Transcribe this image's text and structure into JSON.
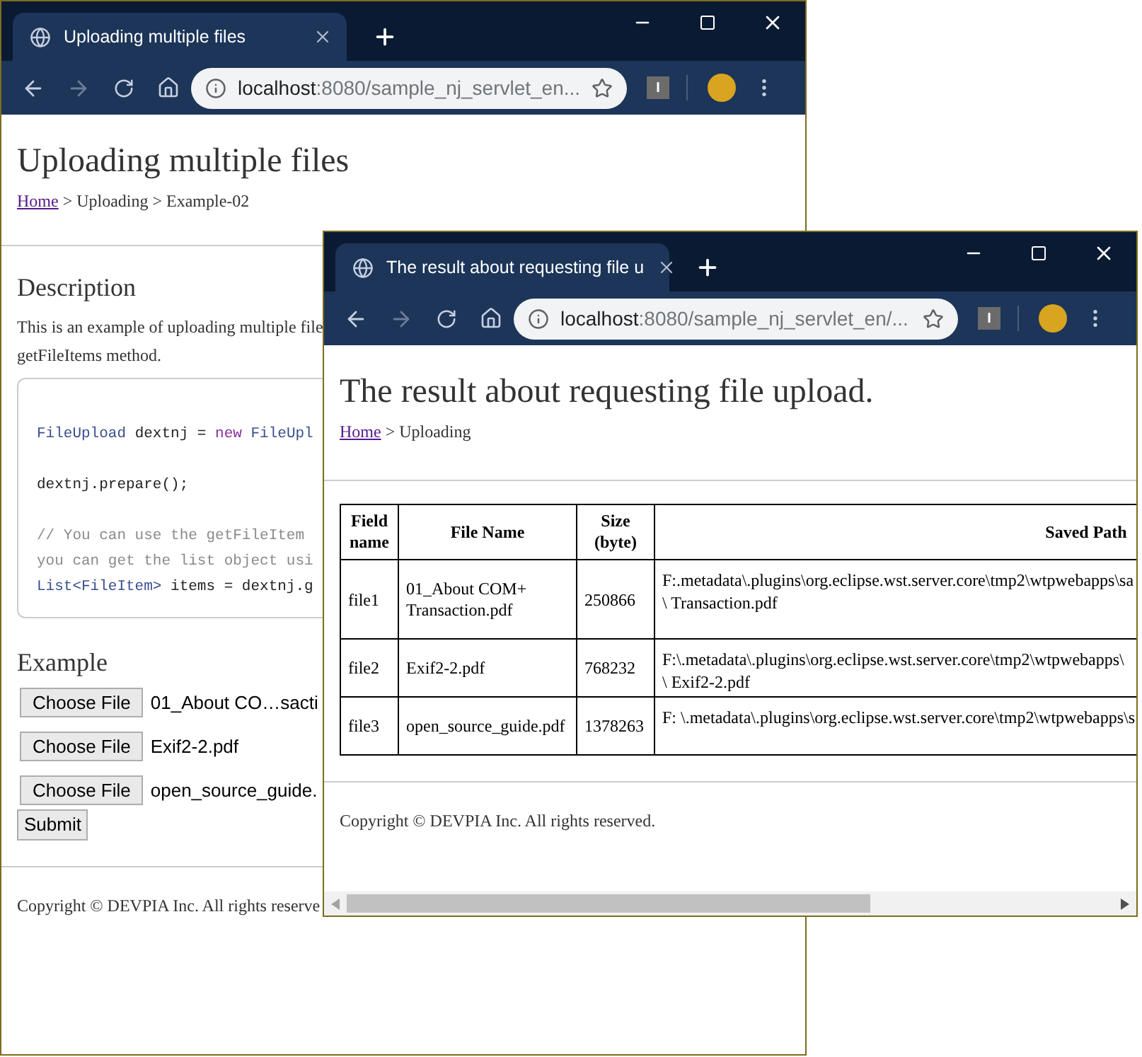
{
  "back_window": {
    "tab_title": "Uploading multiple files",
    "url_host": "localhost",
    "url_rest": ":8080/sample_nj_servlet_en...",
    "nav": {
      "back_disabled": false,
      "forward_disabled": true
    },
    "extension_label": "I",
    "heading": "Uploading multiple files",
    "breadcrumb": {
      "link": "Home",
      "rest": " > Uploading > Example-02"
    },
    "description": {
      "heading": "Description",
      "lines": [
        "This is an example of uploading multiple file",
        "getFileItems method."
      ]
    },
    "code_blocks": [
      [
        [
          {
            "text": "FileUpload",
            "kind": "type"
          },
          {
            "text": " dextnj = ",
            "kind": "plain"
          },
          {
            "text": "new",
            "kind": "keyword"
          },
          {
            "text": " FileUpl",
            "kind": "type"
          }
        ]
      ],
      [
        [
          {
            "text": "dextnj.prepare();",
            "kind": "plain"
          }
        ]
      ],
      [
        [
          {
            "text": "// You can use the getFileItem",
            "kind": "comment"
          }
        ],
        [
          {
            "text": "you can get the list object usi",
            "kind": "comment"
          }
        ],
        [
          {
            "text": "List<FileItem>",
            "kind": "type"
          },
          {
            "text": " items = dextnj.g",
            "kind": "plain"
          }
        ]
      ]
    ],
    "example": {
      "heading": "Example",
      "files": [
        {
          "button": "Choose File",
          "file": "01_About CO…sacti"
        },
        {
          "button": "Choose File",
          "file": "Exif2-2.pdf"
        },
        {
          "button": "Choose File",
          "file": "open_source_guide."
        }
      ],
      "submit": "Submit"
    },
    "footer": "Copyright © DEVPIA Inc. All rights reserve"
  },
  "front_window": {
    "tab_title": "The result about requesting file u",
    "url_host": "localhost",
    "url_rest": ":8080/sample_nj_servlet_en/...",
    "nav": {
      "back_disabled": false,
      "forward_disabled": true
    },
    "extension_label": "I",
    "heading": "The result about requesting file upload.",
    "breadcrumb": {
      "link": "Home",
      "rest": " > Uploading"
    },
    "table": {
      "columns": [
        "Field name",
        "File Name",
        "Size (byte)",
        "Saved Path"
      ],
      "rows": [
        {
          "field": "file1",
          "file_name": "01_About COM+ Transaction.pdf",
          "size": "250866",
          "path": [
            "F:.metadata\\.plugins\\org.eclipse.wst.server.core\\tmp2\\wtpwebapps\\sa",
            "\\ Transaction.pdf"
          ]
        },
        {
          "field": "file2",
          "file_name": "Exif2-2.pdf",
          "size": "768232",
          "path": [
            "F:\\.metadata\\.plugins\\org.eclipse.wst.server.core\\tmp2\\wtpwebapps\\",
            "\\ Exif2-2.pdf"
          ]
        },
        {
          "field": "file3",
          "file_name": "open_source_guide.pdf",
          "size": "1378263",
          "path": [
            "F: \\.metadata\\.plugins\\org.eclipse.wst.server.core\\tmp2\\wtpwebapps\\s"
          ]
        }
      ]
    },
    "footer": "Copyright © DEVPIA Inc. All rights reserved."
  }
}
